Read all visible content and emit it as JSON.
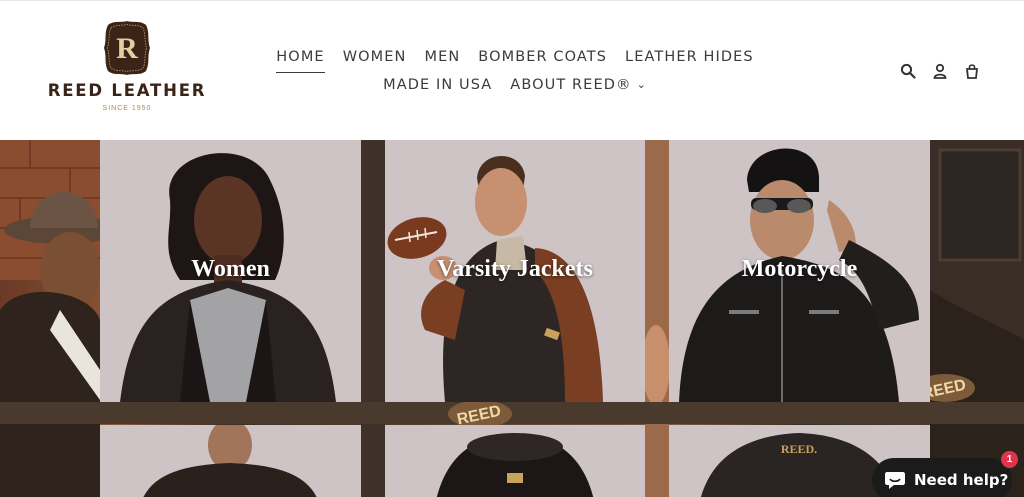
{
  "brand": {
    "badge_letter": "R",
    "name": "REED LEATHER",
    "since": "SINCE 1950"
  },
  "nav": {
    "items": [
      {
        "label": "HOME",
        "active": true
      },
      {
        "label": "WOMEN"
      },
      {
        "label": "MEN"
      },
      {
        "label": "BOMBER COATS"
      },
      {
        "label": "LEATHER HIDES"
      },
      {
        "label": "MADE IN USA"
      },
      {
        "label": "ABOUT REED®",
        "dropdown": true
      }
    ]
  },
  "header_icons": [
    "search-icon",
    "account-icon",
    "cart-icon"
  ],
  "tiles": [
    {
      "title": "Women"
    },
    {
      "title": "Varsity Jackets"
    },
    {
      "title": "Motorcycle"
    }
  ],
  "bottom_tiles": [
    {
      "label": ""
    },
    {
      "label": ""
    },
    {
      "label": "REED."
    }
  ],
  "background_patches": [
    "REED",
    "REED"
  ],
  "chat": {
    "label": "Need help?",
    "badge": "1"
  },
  "colors": {
    "brand_brown": "#3a2418",
    "gold": "#b4893f",
    "tile_bg": "#cec4c6",
    "chat_bg": "#1b1b1b",
    "badge": "#e0344a"
  }
}
